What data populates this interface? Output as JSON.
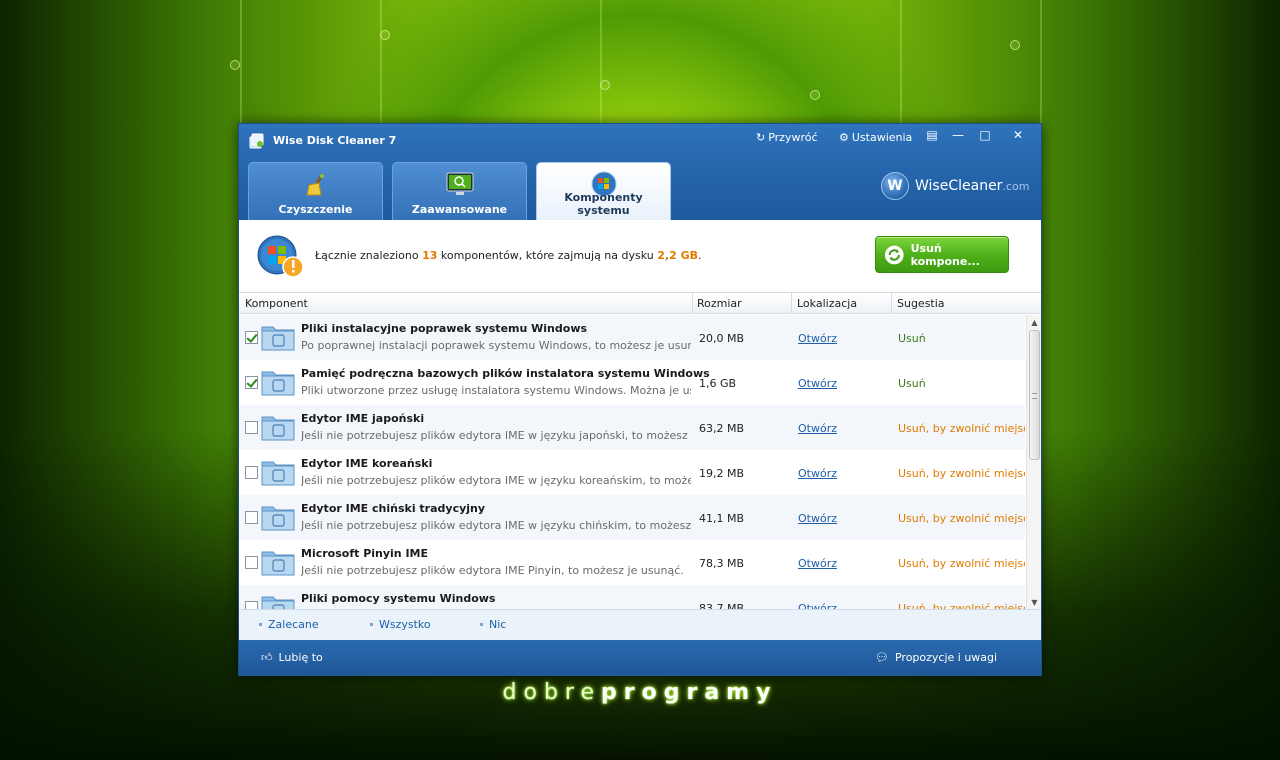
{
  "window": {
    "title": "Wise Disk Cleaner 7",
    "restore_label": "Przywróć",
    "settings_label": "Ustawienia",
    "logo_text": "WiseCleaner",
    "logo_suffix": ".com",
    "logo_letter": "W"
  },
  "tabs": [
    {
      "label": "Czyszczenie",
      "icon": "broom-icon",
      "active": false
    },
    {
      "label": "Zaawansowane",
      "icon": "monitor-search-icon",
      "active": false
    },
    {
      "label": "Komponenty systemu",
      "icon": "windows-logo-icon",
      "active": true
    }
  ],
  "summary": {
    "prefix": "Łącznie znaleziono",
    "count": "13",
    "middle": "komponentów, które zajmują na dysku",
    "size": "2,2 GB",
    "suffix": ".",
    "remove_button": "Usuń kompone..."
  },
  "table": {
    "headers": {
      "component": "Komponent",
      "size": "Rozmiar",
      "location": "Lokalizacja",
      "suggestion": "Sugestia"
    },
    "rows": [
      {
        "checked": true,
        "name": "Pliki instalacyjne poprawek systemu Windows",
        "desc": "Po poprawnej instalacji poprawek systemu Windows, to możesz je usunąć.",
        "size": "20,0 MB",
        "location": "Otwórz",
        "suggestion": "Usuń",
        "type": "ok"
      },
      {
        "checked": true,
        "name": "Pamięć podręczna bazowych plików instalatora systemu Windows",
        "desc": "Pliki utworzone przez usługę instalatora systemu Windows. Można je usunąć.",
        "size": "1,6 GB",
        "location": "Otwórz",
        "suggestion": "Usuń",
        "type": "ok"
      },
      {
        "checked": false,
        "name": "Edytor IME japoński",
        "desc": "Jeśli nie potrzebujesz plików edytora IME w języku japoński, to możesz je usunąć.",
        "size": "63,2 MB",
        "location": "Otwórz",
        "suggestion": "Usuń, by zwolnić miejsce",
        "type": "warn"
      },
      {
        "checked": false,
        "name": "Edytor IME koreański",
        "desc": "Jeśli nie potrzebujesz plików edytora IME w języku koreańskim, to możesz je usun",
        "size": "19,2 MB",
        "location": "Otwórz",
        "suggestion": "Usuń, by zwolnić miejsce",
        "type": "warn"
      },
      {
        "checked": false,
        "name": "Edytor IME chiński tradycyjny",
        "desc": "Jeśli nie potrzebujesz plików edytora IME w języku chińskim, to możesz je usunąć.",
        "size": "41,1 MB",
        "location": "Otwórz",
        "suggestion": "Usuń, by zwolnić miejsce",
        "type": "warn"
      },
      {
        "checked": false,
        "name": "Microsoft Pinyin IME",
        "desc": "Jeśli nie potrzebujesz plików edytora IME Pinyin, to możesz je usunąć.",
        "size": "78,3 MB",
        "location": "Otwórz",
        "suggestion": "Usuń, by zwolnić miejsce",
        "type": "warn"
      },
      {
        "checked": false,
        "name": "Pliki pomocy systemu Windows",
        "desc": "",
        "size": "83,7 MB",
        "location": "Otwórz",
        "suggestion": "Usuń, by zwolnić miejsce",
        "type": "warn"
      }
    ]
  },
  "selection": {
    "recommended": "Zalecane",
    "all": "Wszystko",
    "none": "Nic"
  },
  "footer": {
    "like": "Lubię to",
    "feedback": "Propozycje i uwagi"
  },
  "brand": {
    "thin": "dobre",
    "bold": "programy"
  },
  "colors": {
    "accent_blue": "#2565ab",
    "remove_green": "#4fb11a",
    "highlight_orange": "#e07b00",
    "suggest_green": "#3a7a1a"
  }
}
